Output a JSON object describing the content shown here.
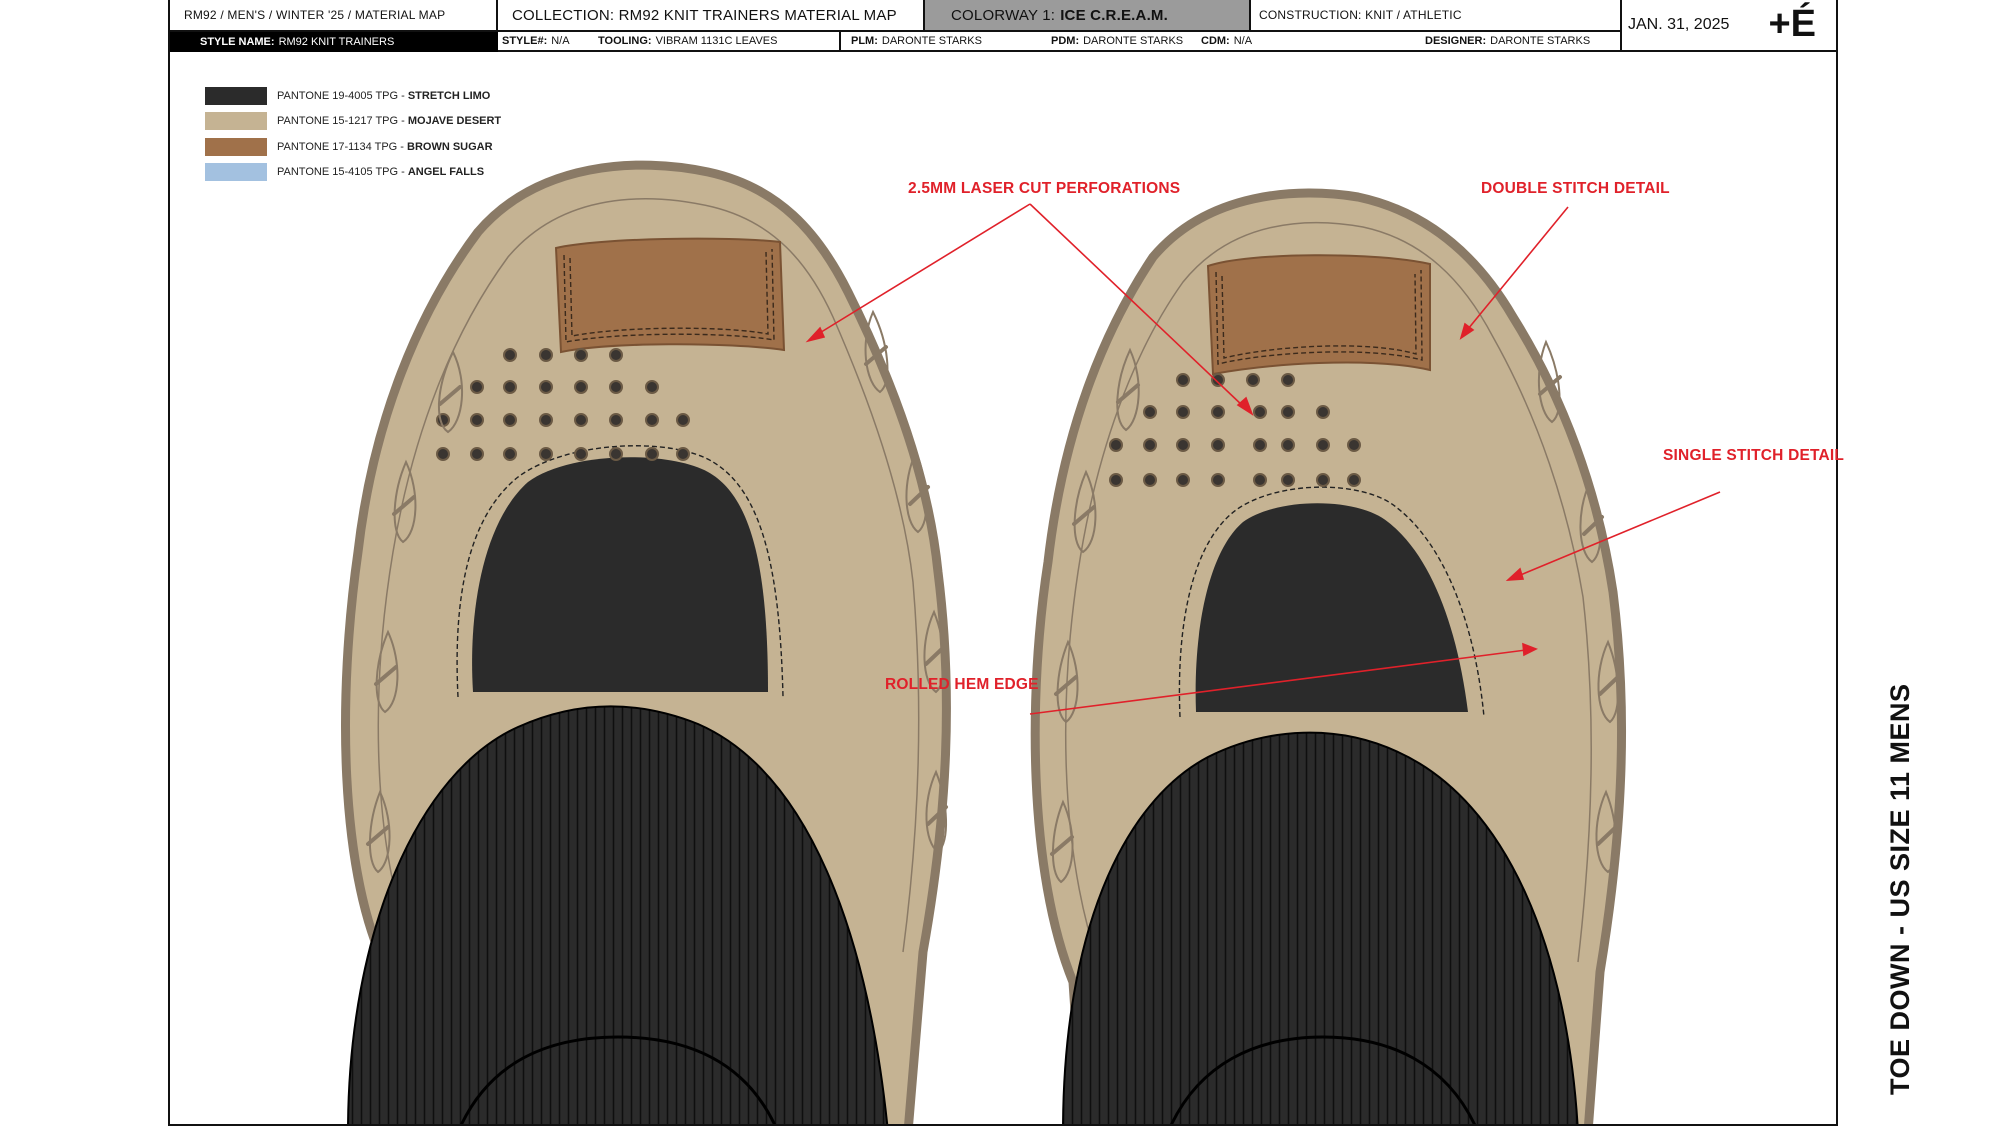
{
  "header": {
    "season": "RM92 / MEN'S / WINTER '25 / MATERIAL MAP",
    "collection": "COLLECTION: RM92 KNIT TRAINERS MATERIAL MAP",
    "colorway_label": "COLORWAY 1:",
    "colorway_value": "ICE C.R.E.A.M.",
    "construction": "CONSTRUCTION: KNIT / ATHLETIC",
    "date": "JAN. 31, 2025",
    "logo": "+É",
    "style_name_label": "STYLE NAME:",
    "style_name_value": "RM92 KNIT TRAINERS",
    "style_no_label": "STYLE#:",
    "style_no_value": "N/A",
    "tooling_label": "TOOLING:",
    "tooling_value": "VIBRAM 1131C LEAVES",
    "plm_label": "PLM:",
    "plm_value": "DARONTE STARKS",
    "pdm_label": "PDM:",
    "pdm_value": "DARONTE STARKS",
    "cdm_label": "CDM:",
    "cdm_value": "N/A",
    "designer_label": "DESIGNER:",
    "designer_value": "DARONTE STARKS"
  },
  "legend": [
    {
      "code": "PANTONE 19-4005 TPG - ",
      "name": "STRETCH LIMO",
      "color": "#2b2b2b"
    },
    {
      "code": "PANTONE 15-1217 TPG - ",
      "name": "MOJAVE DESERT",
      "color": "#c5b393"
    },
    {
      "code": "PANTONE 17-1134 TPG - ",
      "name": "BROWN SUGAR",
      "color": "#a0714a"
    },
    {
      "code": "PANTONE 15-4105 TPG - ",
      "name": "ANGEL FALLS",
      "color": "#a3c1e0"
    }
  ],
  "callouts": {
    "perforations": "2.5MM LASER CUT PERFORATIONS",
    "double_stitch": "DOUBLE STITCH DETAIL",
    "single_stitch": "SINGLE STITCH DETAIL",
    "rolled_hem": "ROLLED HEM EDGE"
  },
  "side_label": "TOE DOWN - US SIZE 11 MENS",
  "colors": {
    "accent_red": "#e0212a",
    "header_grey": "#9b9b9b",
    "sole_outline": "#8a7a66"
  }
}
